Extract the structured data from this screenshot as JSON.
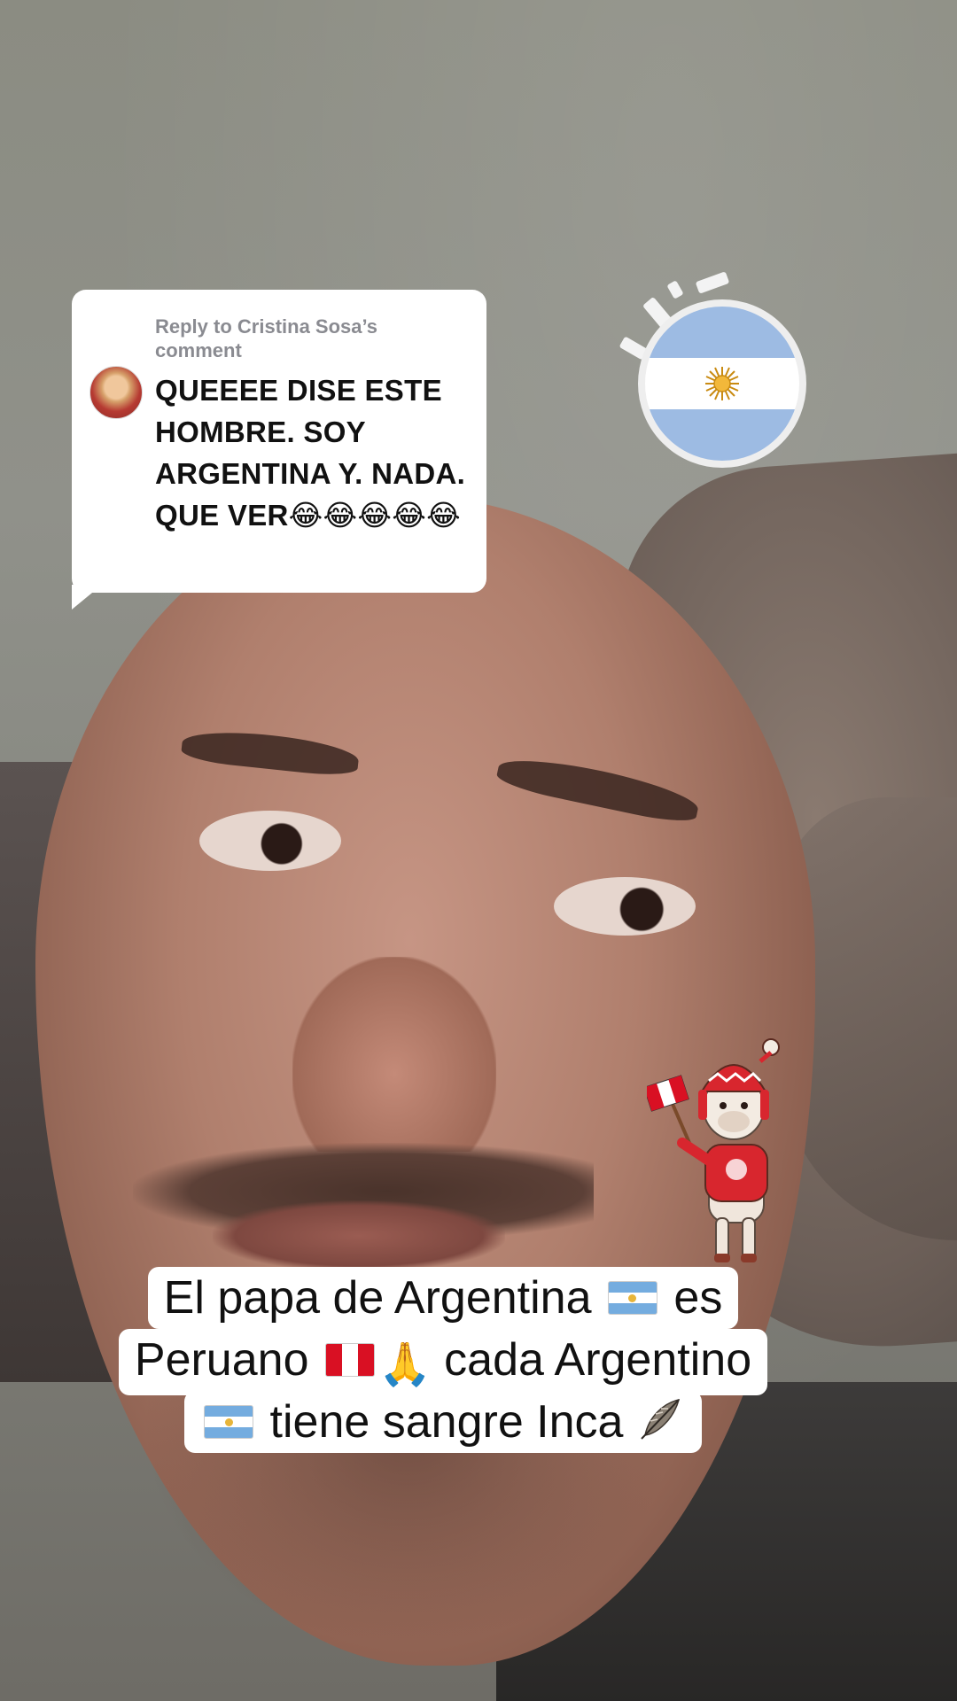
{
  "reply": {
    "header": "Reply to Cristina Sosa’s comment",
    "text": "QUEEEE DISE ESTE HOMBRE. SOY ARGENTINA Y. NADA. QUE VER😂😂😂😂😂"
  },
  "caption": {
    "line1_a": "El papa de Argentina",
    "line1_b": "es",
    "line2_a": "Peruano",
    "line2_emoji": "🙏",
    "line2_b": "cada Argentino",
    "line3_a": "tiene sangre Inca"
  },
  "colors": {
    "argentina_blue": "#74acdf",
    "peru_red": "#d91023",
    "card_bg": "#ffffff",
    "header_gray": "#8a8b91"
  },
  "stickers": {
    "flag_sticker_icon": "argentina-flag-circle-icon",
    "alpaca_icon": "alpaca-peru-flag-icon"
  }
}
